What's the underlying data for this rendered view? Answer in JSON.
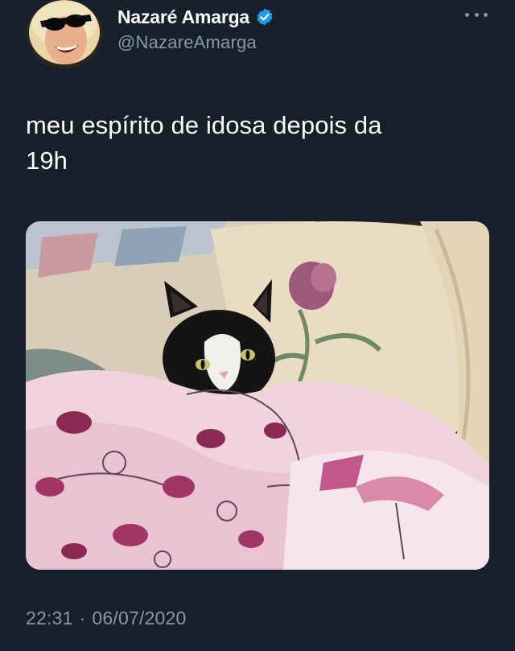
{
  "tweet": {
    "author": {
      "display_name": "Nazaré Amarga",
      "handle": "@NazareAmarga",
      "verified": true
    },
    "text": "meu espírito de idosa depois da\n19h",
    "time": "22:31",
    "separator": "·",
    "date": "06/07/2020"
  },
  "icons": {
    "verified": "verified-badge-icon",
    "more": "more-options-icon"
  },
  "colors": {
    "background": "#15202b",
    "secondary_text": "#8899a6",
    "verified_blue": "#1d9bf0"
  }
}
